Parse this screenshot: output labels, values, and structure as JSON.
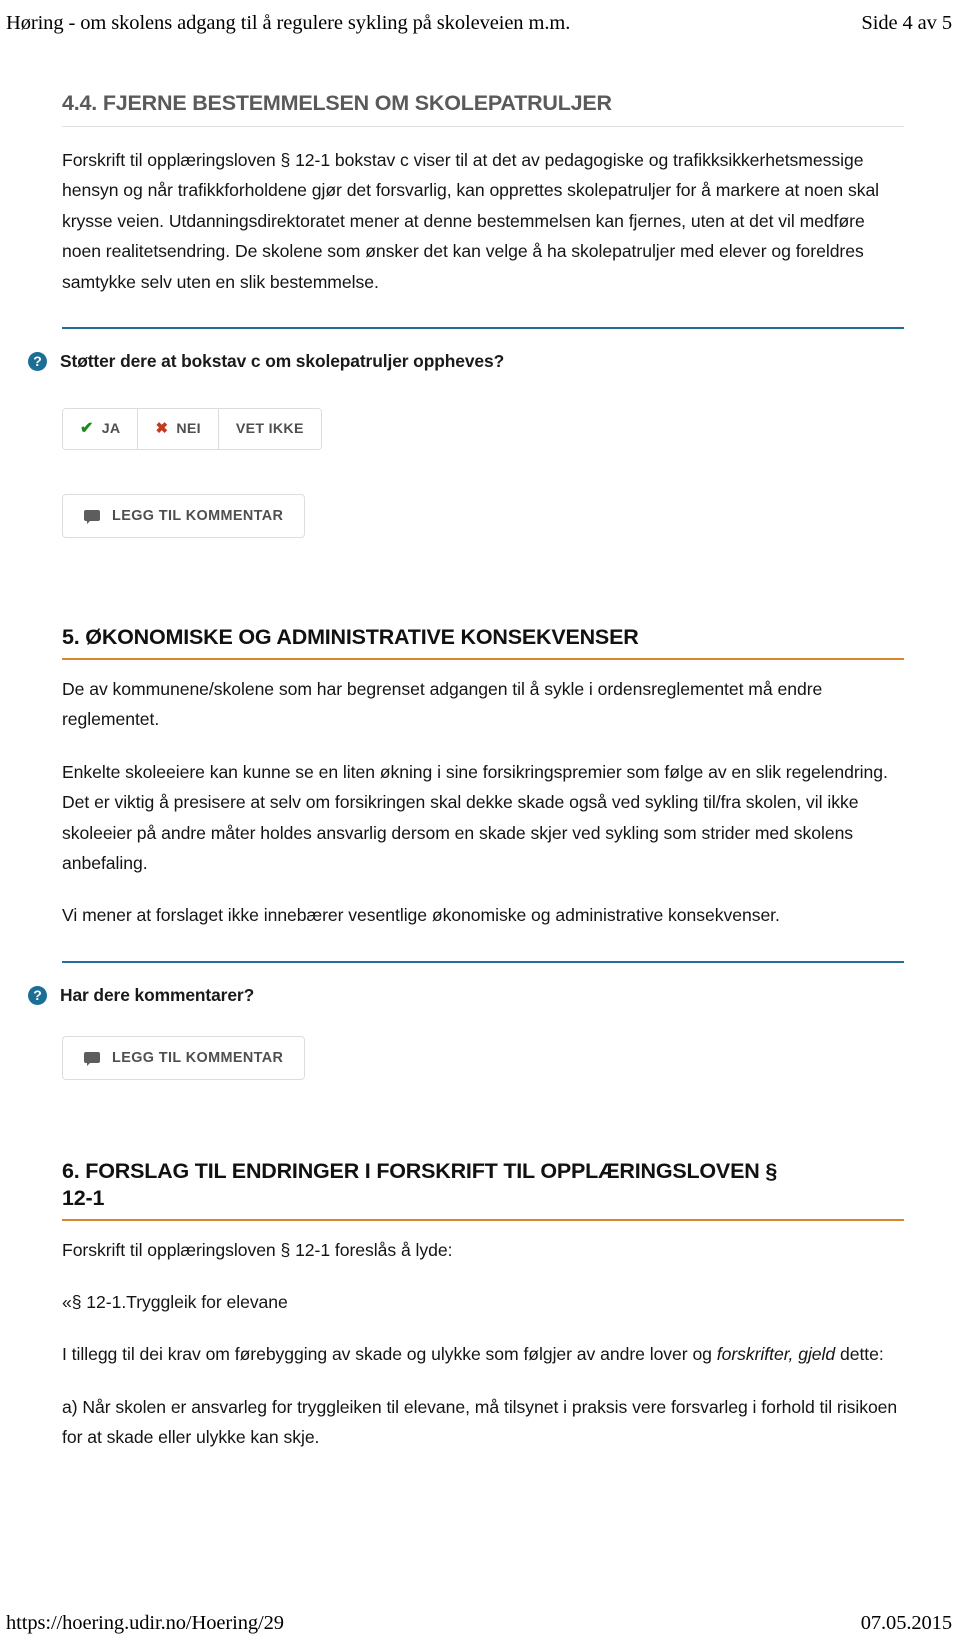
{
  "header": {
    "left": "Høring - om skolens adgang til å regulere sykling på skoleveien m.m.",
    "right": "Side 4 av 5"
  },
  "footer": {
    "url": "https://hoering.udir.no/Hoering/29",
    "date": "07.05.2015"
  },
  "sections": {
    "s44": {
      "heading": "4.4. FJERNE BESTEMMELSEN OM SKOLEPATRULJER",
      "paragraph": "Forskrift til opplæringsloven § 12-1 bokstav c viser til at det av pedagogiske og trafikksikkerhetsmessige hensyn og når trafikkforholdene gjør det forsvarlig, kan opprettes skolepatruljer for å markere at noen skal krysse veien. Utdanningsdirektoratet mener at denne bestemmelsen kan fjernes, uten at det vil medføre noen realitetsendring. De skolene som ønsker det kan velge å ha skolepatruljer med elever og foreldres samtykke selv uten en slik bestemmelse."
    },
    "s5": {
      "heading": "5. ØKONOMISKE OG ADMINISTRATIVE KONSEKVENSER",
      "paragraph1": "De av kommunene/skolene som har begrenset adgangen til å sykle i ordensreglementet må endre reglementet.",
      "paragraph2": "Enkelte skoleeiere kan kunne se en liten økning i sine forsikringspremier som følge av en slik regelendring. Det er viktig å presisere at selv om forsikringen skal dekke skade også ved sykling til/fra skolen, vil ikke skoleeier på andre måter holdes ansvarlig dersom en skade skjer ved sykling som strider med skolens anbefaling.",
      "paragraph3": "Vi mener at forslaget ikke innebærer vesentlige økonomiske og administrative konsekvenser."
    },
    "s6": {
      "heading_line1": "6. FORSLAG TIL ENDRINGER I FORSKRIFT TIL OPPLÆRINGSLOVEN §",
      "heading_line2": "12-1",
      "paragraph1": "Forskrift til opplæringsloven § 12-1 foreslås å lyde:",
      "paragraph2": "«§ 12-1.Tryggleik for elevane",
      "paragraph3_pre": "I tillegg til dei krav om førebygging av skade og ulykke som følgjer av andre lover og ",
      "paragraph3_italic": "forskrifter, gjeld",
      "paragraph3_post": " dette:",
      "paragraph4": "a) Når skolen er ansvarleg for tryggleiken til elevane, må tilsynet i praksis vere forsvarleg i forhold til risikoen for at skade eller ulykke kan skje."
    }
  },
  "questions": [
    {
      "icon": "question-mark-icon",
      "text": "Støtter dere at bokstav c om skolepatruljer oppheves?",
      "options": [
        {
          "icon": "check-icon",
          "label": "JA"
        },
        {
          "icon": "cross-icon",
          "label": "NEI"
        },
        {
          "icon": "",
          "label": "VET IKKE"
        }
      ],
      "comment_button": {
        "icon": "comment-bubble-icon",
        "label": "LEGG TIL KOMMENTAR"
      }
    },
    {
      "icon": "question-mark-icon",
      "text": "Har dere kommentarer?",
      "comment_button": {
        "icon": "comment-bubble-icon",
        "label": "LEGG TIL KOMMENTAR"
      }
    }
  ],
  "icons": {
    "question_glyph": "?",
    "check_glyph": "✔",
    "cross_glyph": "✖"
  },
  "colors": {
    "accent_blue": "#1b6e96",
    "accent_orange": "#d8872f",
    "yes_green": "#1c8a1c",
    "no_red": "#bf3b22"
  }
}
